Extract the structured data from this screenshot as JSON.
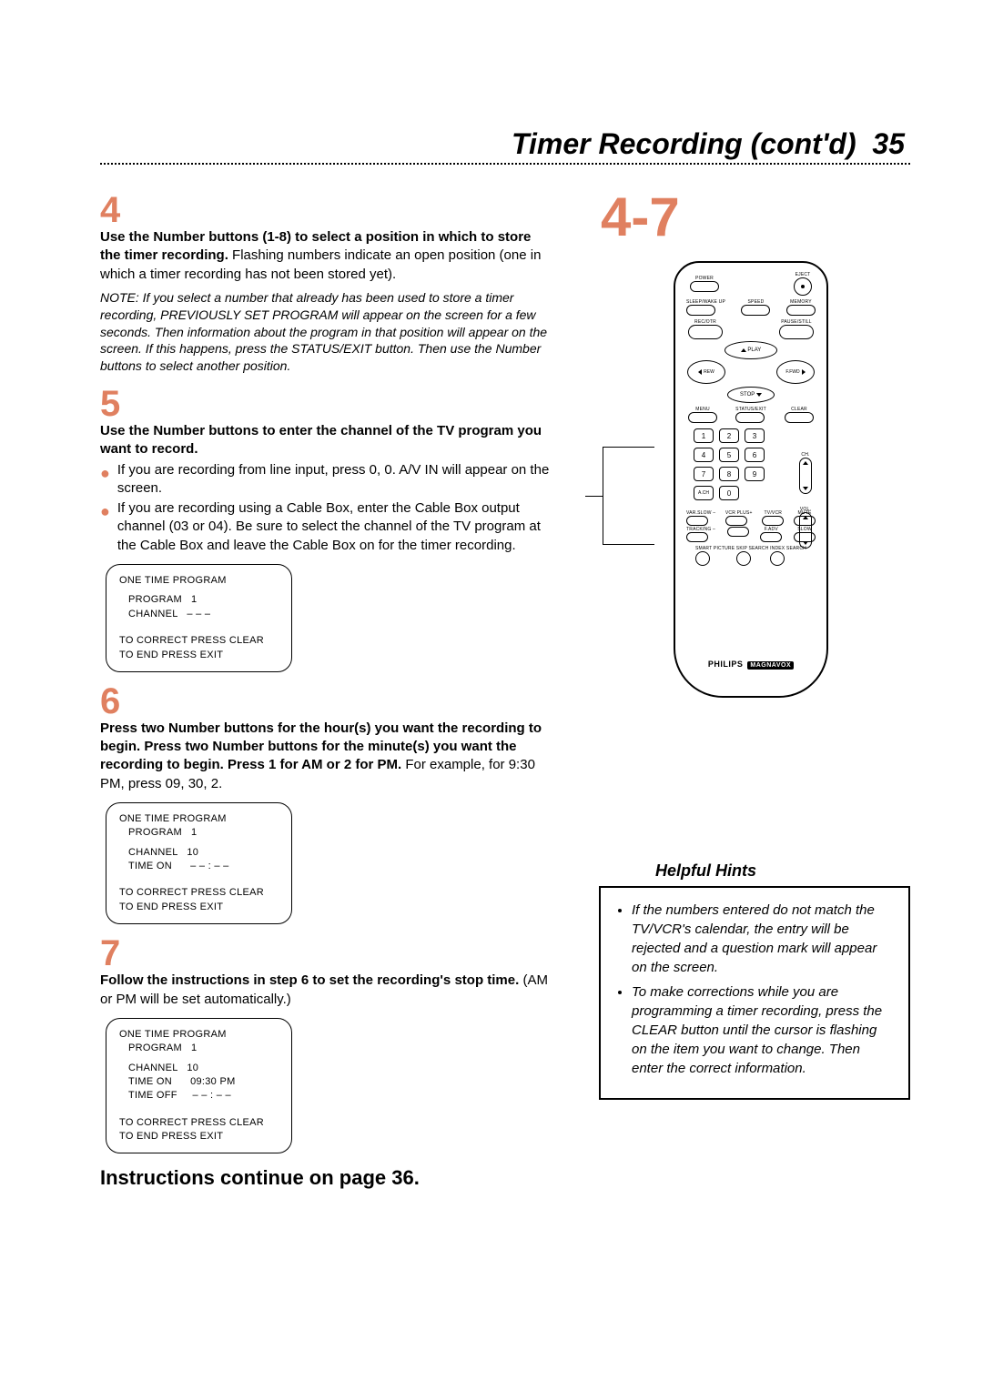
{
  "page": {
    "title": "Timer Recording (cont'd)",
    "number": "35"
  },
  "step4": {
    "num": "4",
    "bold": "Use the Number buttons (1-8) to select a position in which to store the timer recording.",
    "rest": " Flashing numbers indicate an open position (one in which a timer recording has not been stored yet).",
    "note": "NOTE: If you select a number that already has been used to store a timer recording, PREVIOUSLY SET PROGRAM will appear on the screen for a few seconds. Then information about the program in that position will appear on the screen. If this happens, press the STATUS/EXIT button. Then use the Number buttons to select another position."
  },
  "bigref": "4-7",
  "step5": {
    "num": "5",
    "bold": "Use the Number buttons to enter the channel of the TV program you want to record.",
    "bul1": "If you are recording from line input, press 0, 0. A/V IN will appear on the screen.",
    "bul2": "If you are recording using a Cable Box, enter the Cable Box output channel (03 or 04). Be sure to select the channel of the TV program at the Cable Box and leave the Cable Box on for the timer recording.",
    "screen": {
      "l1": "ONE TIME PROGRAM",
      "l2": "PROGRAM   1",
      "l3": "CHANNEL   – – –",
      "l4": "TO CORRECT PRESS CLEAR",
      "l5": "TO END PRESS EXIT"
    }
  },
  "step6": {
    "num": "6",
    "bold": "Press two Number buttons for the hour(s) you want the recording to begin. Press two Number buttons for the minute(s) you want the recording to begin. Press 1 for AM or 2 for PM.",
    "rest": " For example, for 9:30 PM, press 09, 30, 2.",
    "screen": {
      "l1": "ONE TIME PROGRAM",
      "l2": "PROGRAM   1",
      "l3": "CHANNEL   10",
      "l4": "TIME ON      – – : – –",
      "l5": "TO CORRECT PRESS CLEAR",
      "l6": "TO END PRESS EXIT"
    }
  },
  "step7": {
    "num": "7",
    "bold": "Follow the instructions in step 6 to set the recording's stop time.",
    "rest": " (AM or PM will be set automatically.)",
    "screen": {
      "l1": "ONE TIME PROGRAM",
      "l2": "PROGRAM   1",
      "l3": "CHANNEL   10",
      "l4": "TIME ON      09:30 PM",
      "l5": "TIME OFF     – – : – –",
      "l6": "TO CORRECT PRESS CLEAR",
      "l7": "TO END PRESS EXIT"
    }
  },
  "continue": "Instructions continue on page 36.",
  "remote": {
    "power": "POWER",
    "eject": "EJECT",
    "sleep": "SLEEP/WAKE UP",
    "speed": "SPEED",
    "memory": "MEMORY",
    "recotr": "REC/OTR",
    "pausestill": "PAUSE/STILL",
    "play": "PLAY",
    "rew": "REW",
    "ffwd": "F.FWD",
    "stop": "STOP",
    "menu": "MENU",
    "status": "STATUS/EXIT",
    "clear": "CLEAR",
    "ach": "A.CH",
    "ch": "CH.",
    "vol": "VOL.",
    "varslow_minus": "VAR.SLOW –",
    "varslow_plus": "VCR PLUS+",
    "tvvcr": "TV/VCR",
    "mute": "MUTE",
    "track_minus": "TRACKING –",
    "fadv": "F.ADV",
    "slow": "SLOW",
    "smart": "SMART PICTURE",
    "skip": "SKIP SEARCH",
    "index": "INDEX SEARCH",
    "num": {
      "1": "1",
      "2": "2",
      "3": "3",
      "4": "4",
      "5": "5",
      "6": "6",
      "7": "7",
      "8": "8",
      "9": "9",
      "0": "0"
    },
    "brand": "PHILIPS",
    "brandtag": "MAGNAVOX"
  },
  "hints": {
    "title": "Helpful Hints",
    "h1": "If the numbers entered do not match the TV/VCR's calendar, the entry will be rejected and a question mark will appear on the screen.",
    "h2": "To make corrections while you are programming a timer recording, press the CLEAR button until the cursor is flashing on the item you want to change. Then enter the correct information."
  }
}
